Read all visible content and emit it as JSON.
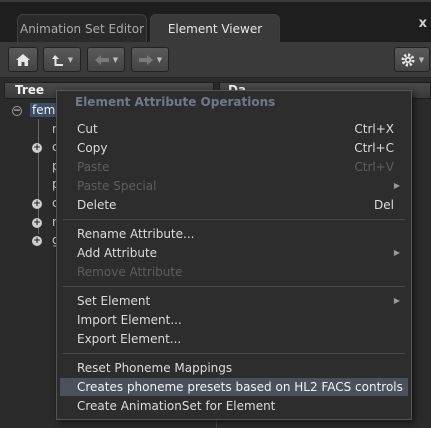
{
  "tabs": [
    "Animation Set Editor",
    "Element Viewer"
  ],
  "close_label": "x",
  "toolbar": {
    "home_icon": "home-icon",
    "up_icon": "up-arrow-icon",
    "back_icon": "back-arrow-icon",
    "forward_icon": "forward-arrow-icon",
    "settings_icon": "gear-icon"
  },
  "tree": {
    "header": "Tree",
    "data_header": "Da",
    "selected_item": "fema",
    "rows": [
      "n",
      "c",
      "p",
      "p",
      "c",
      "n",
      "g"
    ]
  },
  "menu": {
    "title": "Element Attribute Operations",
    "items": [
      {
        "label": "Cut",
        "shortcut": "Ctrl+X",
        "disabled": false
      },
      {
        "label": "Copy",
        "shortcut": "Ctrl+C",
        "disabled": false
      },
      {
        "label": "Paste",
        "shortcut": "Ctrl+V",
        "disabled": true
      },
      {
        "label": "Paste Special",
        "shortcut": "",
        "disabled": true
      },
      {
        "label": "Delete",
        "shortcut": "Del",
        "disabled": false
      },
      {
        "label": "Rename Attribute...",
        "shortcut": "",
        "disabled": false
      },
      {
        "label": "Add Attribute",
        "shortcut": "",
        "disabled": false
      },
      {
        "label": "Remove Attribute",
        "shortcut": "",
        "disabled": true
      },
      {
        "label": "Set Element",
        "shortcut": "",
        "disabled": false
      },
      {
        "label": "Import Element...",
        "shortcut": "",
        "disabled": false
      },
      {
        "label": "Export Element...",
        "shortcut": "",
        "disabled": false
      },
      {
        "label": "Reset Phoneme Mappings",
        "shortcut": "",
        "disabled": false
      },
      {
        "label": "Creates phoneme presets based on HL2 FACS controls",
        "shortcut": "",
        "disabled": false
      },
      {
        "label": "Create AnimationSet for Element",
        "shortcut": "",
        "disabled": false
      }
    ]
  }
}
